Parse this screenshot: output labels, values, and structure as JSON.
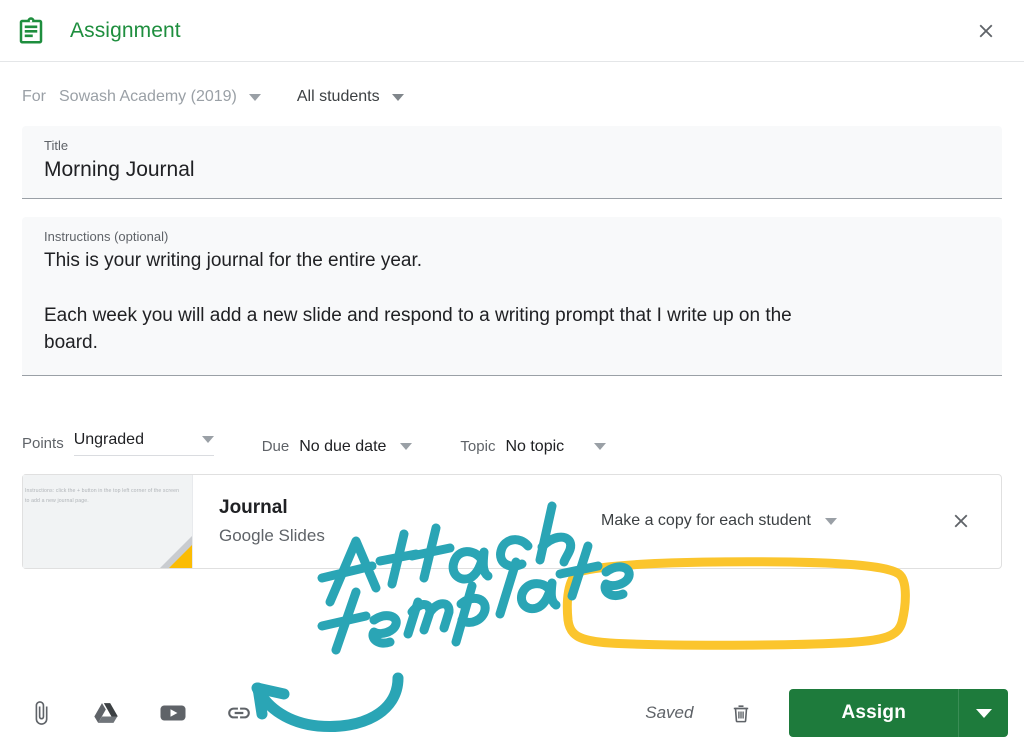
{
  "colors": {
    "brand_green": "#1e8e3e",
    "assign_button_green": "#1e7b3c",
    "annotation_teal": "#2aa5b5",
    "annotation_yellow": "#fbc52d",
    "slides_yellow": "#fbbc04",
    "field_background": "#f8f9fa",
    "muted_text": "#9aa0a6",
    "primary_text": "#202124"
  },
  "header": {
    "icon": "assignment-clipboard-icon",
    "title": "Assignment",
    "close_icon": "close-icon"
  },
  "for_row": {
    "label": "For",
    "course": "Sowash Academy (2019)",
    "course_caret_icon": "chevron-down-icon",
    "students": "All students",
    "students_caret_icon": "chevron-down-icon"
  },
  "title_field": {
    "label": "Title",
    "value": "Morning Journal"
  },
  "instructions_field": {
    "label": "Instructions (optional)",
    "line1": "This is your writing journal for the entire year.",
    "line2": "Each week you will add a new slide and respond to a writing prompt that I write up on the",
    "line3": "board."
  },
  "meta": {
    "points_label": "Points",
    "points_value": "Ungraded",
    "due_label": "Due",
    "due_value": "No due date",
    "topic_label": "Topic",
    "topic_value": "No topic",
    "caret_icon": "chevron-down-icon"
  },
  "attachment": {
    "thumbnail_text": "Instructions: click the + button in the top left corner of the screen to add a new journal page.",
    "title": "Journal",
    "subtitle": "Google Slides",
    "copy_option": "Make a copy for each student",
    "copy_caret_icon": "chevron-down-icon",
    "remove_icon": "close-icon"
  },
  "bottom_bar": {
    "tools": [
      {
        "name": "paperclip-icon"
      },
      {
        "name": "google-drive-icon"
      },
      {
        "name": "youtube-icon"
      },
      {
        "name": "link-icon"
      }
    ],
    "saved_text": "Saved",
    "trash_icon": "trash-icon",
    "assign_label": "Assign",
    "assign_caret_icon": "chevron-down-icon"
  },
  "annotations": {
    "handwritten_text": "Attach template",
    "arrow": "curved-arrow",
    "highlight_circle": "yellow-circle-around-copy-dropdown"
  }
}
